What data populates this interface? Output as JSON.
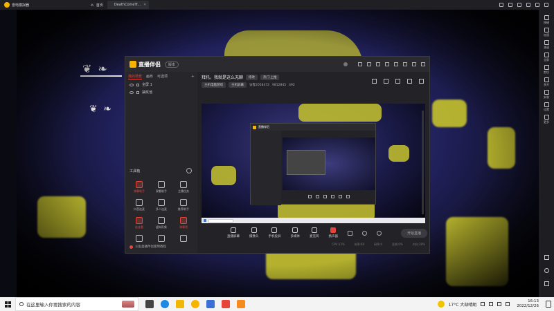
{
  "emulator": {
    "app_name": "雷电模拟器",
    "tabs": [
      {
        "label": "首页"
      },
      {
        "label": "DeathComeTr..."
      }
    ],
    "sidebar": [
      {
        "label": "按键",
        "icon": "keyboard-icon"
      },
      {
        "label": "加速",
        "icon": "speed-icon"
      },
      {
        "label": "减速",
        "icon": "slow-icon"
      },
      {
        "label": "全屏",
        "icon": "fullscreen-icon"
      },
      {
        "label": "剪切",
        "icon": "cut-icon"
      },
      {
        "label": "多开",
        "icon": "multi-instance-icon"
      },
      {
        "label": "安装",
        "icon": "install-icon"
      },
      {
        "label": "设置",
        "icon": "gear-icon"
      },
      {
        "label": "更多",
        "icon": "more-icon"
      }
    ]
  },
  "stream_app": {
    "name": "直播伴侣",
    "version": "版本",
    "left_tabs": [
      "我的场景",
      "画布",
      "可选项"
    ],
    "scenes": [
      "全屏 1",
      "抽奖池"
    ],
    "tools_title": "工具箱",
    "tools": [
      {
        "label": "弹幕助手",
        "red": true
      },
      {
        "label": "观看助手",
        "red": false
      },
      {
        "label": "主播任务",
        "red": false
      },
      {
        "label": "抖音连麦",
        "red": false
      },
      {
        "label": "多人连麦",
        "red": false
      },
      {
        "label": "推荐助手",
        "red": false
      },
      {
        "label": "连连看",
        "red": true
      },
      {
        "label": "虚拟形象",
        "red": false
      },
      {
        "label": "弹幕墙",
        "red": true
      },
      {
        "label": "",
        "red": false
      },
      {
        "label": "",
        "red": false
      },
      {
        "label": "",
        "red": false
      }
    ],
    "promo": "斗鱼直播伴侣使用教程",
    "room_title": "拜托，我就是这么无聊",
    "room_chip": "修改",
    "room_tag": "热门·上推",
    "info_line": [
      "主机电脑游戏",
      "主机屏幕",
      "访客2058472",
      "9812845",
      "492"
    ],
    "controls": [
      {
        "label": "直播屏幕",
        "red": false
      },
      {
        "label": "摄像头",
        "red": false
      },
      {
        "label": "手机投屏",
        "red": false
      },
      {
        "label": "多媒体",
        "red": false
      },
      {
        "label": "麦克风",
        "red": false
      },
      {
        "label": "扬声器",
        "red": true
      }
    ],
    "start_button": "开始直播",
    "status": [
      "CPU:12%",
      "帧率:60",
      "码率:0",
      "丢帧:0%",
      "内存:20%"
    ]
  },
  "taskbar": {
    "search_placeholder": "在这里输入你要搜索的内容",
    "weather": "17°C  大部晴朗",
    "time": "16:13",
    "date": "2022/12/26"
  }
}
